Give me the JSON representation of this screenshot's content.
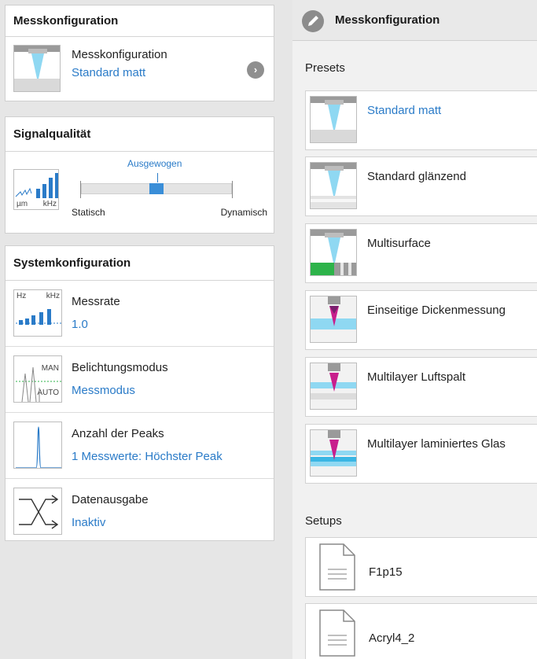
{
  "left": {
    "messkonfiguration": {
      "title": "Messkonfiguration",
      "label": "Messkonfiguration",
      "value": "Standard matt"
    },
    "signalqualitaet": {
      "title": "Signalqualität",
      "thumb_unit_left": "µm",
      "thumb_unit_right": "kHz",
      "slider_marker": "Ausgewogen",
      "slider_left": "Statisch",
      "slider_right": "Dynamisch"
    },
    "systemkonfiguration": {
      "title": "Systemkonfiguration",
      "items": [
        {
          "label": "Messrate",
          "value": "1.0",
          "thumb_left": "Hz",
          "thumb_right": "kHz"
        },
        {
          "label": "Belichtungsmodus",
          "value": "Messmodus",
          "thumb_top": "MAN",
          "thumb_bottom": "AUTO"
        },
        {
          "label": "Anzahl der Peaks",
          "value": "1 Messwerte: Höchster Peak"
        },
        {
          "label": "Datenausgabe",
          "value": "Inaktiv"
        }
      ]
    }
  },
  "right": {
    "title": "Messkonfiguration",
    "presets_heading": "Presets",
    "presets": [
      {
        "label": "Standard matt"
      },
      {
        "label": "Standard glänzend"
      },
      {
        "label": "Multisurface"
      },
      {
        "label": "Einseitige Dickenmessung"
      },
      {
        "label": "Multilayer Luftspalt"
      },
      {
        "label": "Multilayer laminiertes Glas"
      }
    ],
    "setups_heading": "Setups",
    "setups": [
      {
        "label": "F1p15"
      },
      {
        "label": "Acryl4_2"
      }
    ]
  },
  "colors": {
    "accent": "#2a7bc8",
    "green": "#2db34a",
    "magenta": "#c81e8c",
    "cyan": "#6ed0ee"
  }
}
